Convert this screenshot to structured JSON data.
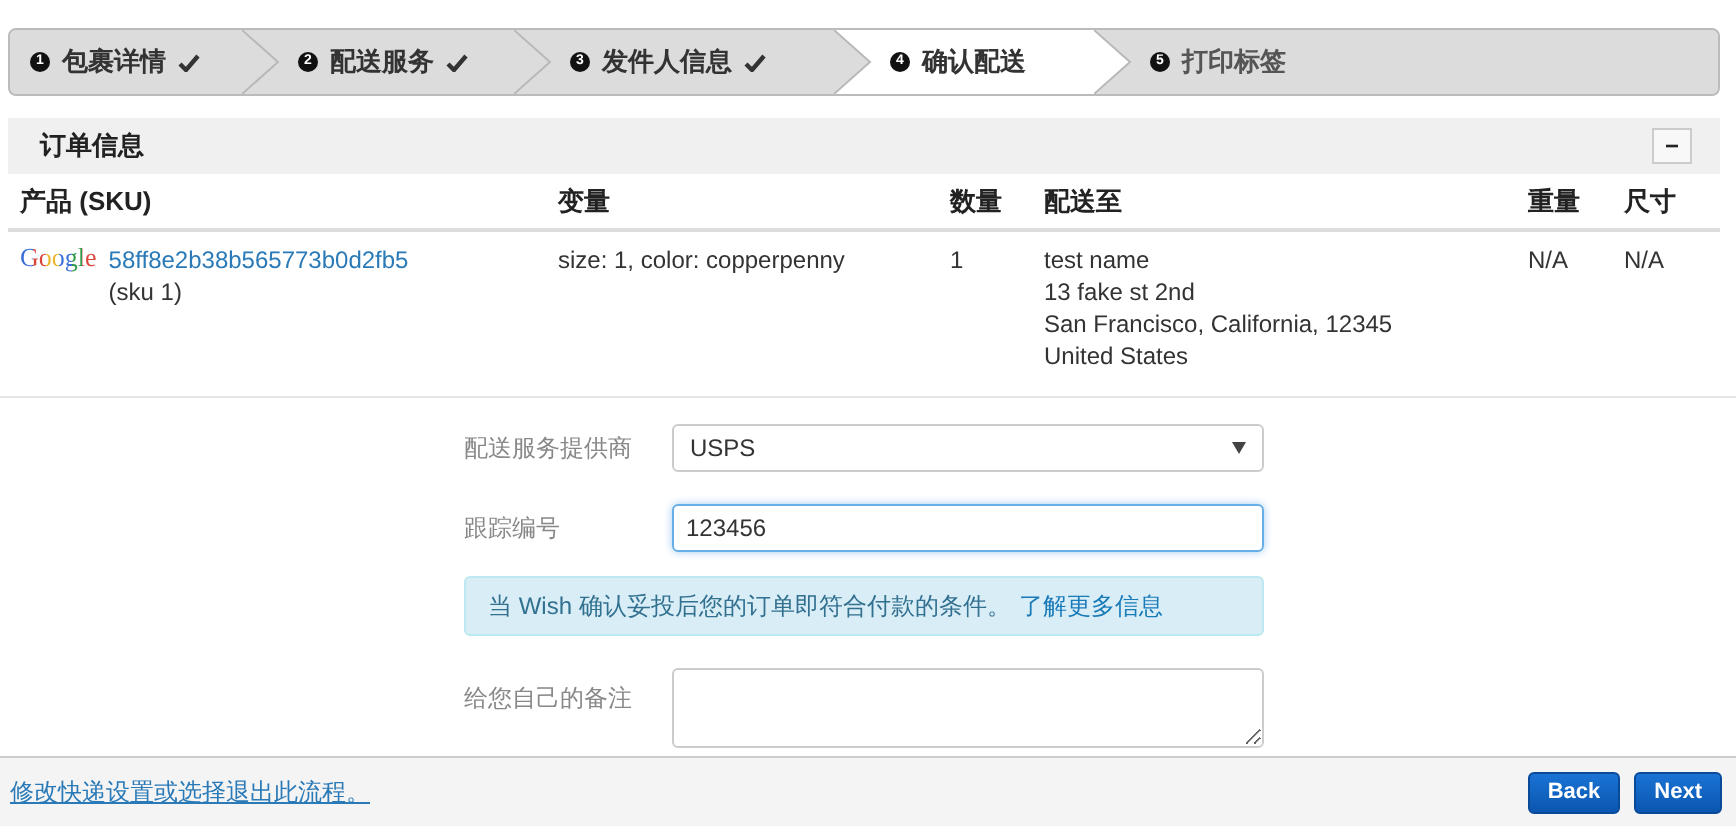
{
  "steps": [
    {
      "number": "1",
      "label": "包裹详情",
      "done": true,
      "selected": false
    },
    {
      "number": "2",
      "label": "配送服务",
      "done": true,
      "selected": false
    },
    {
      "number": "3",
      "label": "发件人信息",
      "done": true,
      "selected": false
    },
    {
      "number": "4",
      "label": "确认配送",
      "done": false,
      "selected": true
    },
    {
      "number": "5",
      "label": "打印标签",
      "done": false,
      "selected": false
    }
  ],
  "order_panel": {
    "title": "订单信息",
    "collapse_symbol": "−",
    "columns": [
      "产品 (SKU)",
      "变量",
      "数量",
      "配送至",
      "重量",
      "尺寸"
    ],
    "rows": [
      {
        "brand": "Google",
        "product_id": "58ff8e2b38b565773b0d2fb5",
        "sku": "(sku 1)",
        "variation": "size: 1, color: copperpenny",
        "quantity": "1",
        "ship_to": [
          "test name",
          "13 fake st 2nd",
          "San Francisco, California, 12345",
          "United States"
        ],
        "weight": "N/A",
        "size": "N/A"
      }
    ]
  },
  "form": {
    "provider_label": "配送服务提供商",
    "provider_value": "USPS",
    "tracking_label": "跟踪编号",
    "tracking_value": "123456",
    "notice": "当 Wish 确认妥投后您的订单即符合付款的条件。",
    "notice_link": "了解更多信息",
    "notes_label": "给您自己的备注"
  },
  "footer": {
    "link": "修改快递设置或选择退出此流程。",
    "buttons": [
      "Back",
      "Next"
    ]
  }
}
